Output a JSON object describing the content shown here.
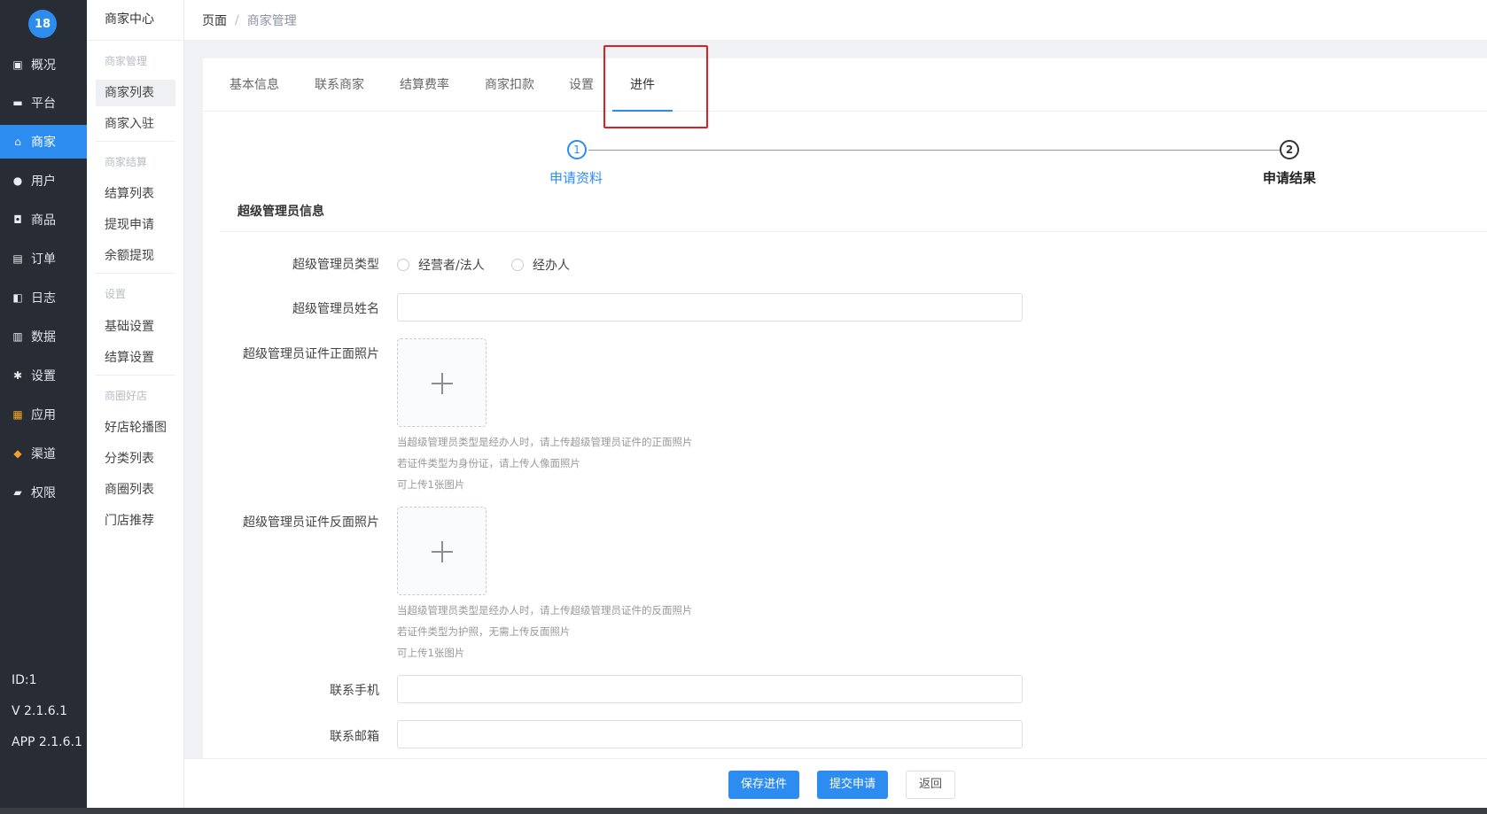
{
  "nav": {
    "logo": "18",
    "items": [
      {
        "label": "概况",
        "icon": "dashboard-icon"
      },
      {
        "label": "平台",
        "icon": "monitor-icon"
      },
      {
        "label": "商家",
        "icon": "shop-icon"
      },
      {
        "label": "用户",
        "icon": "user-icon"
      },
      {
        "label": "商品",
        "icon": "goods-icon"
      },
      {
        "label": "订单",
        "icon": "order-icon"
      },
      {
        "label": "日志",
        "icon": "log-icon"
      },
      {
        "label": "数据",
        "icon": "chart-icon"
      },
      {
        "label": "设置",
        "icon": "gear-icon"
      },
      {
        "label": "应用",
        "icon": "apps-icon"
      },
      {
        "label": "渠道",
        "icon": "cube-icon"
      },
      {
        "label": "权限",
        "icon": "lock-icon"
      }
    ],
    "id": "ID:1",
    "version": "V 2.1.6.1",
    "app_version": "APP 2.1.6.1"
  },
  "submenu": {
    "title": "商家中心",
    "groups": [
      {
        "title": "商家管理",
        "links": [
          "商家列表",
          "商家入驻"
        ]
      },
      {
        "title": "商家结算",
        "links": [
          "结算列表",
          "提现申请",
          "余额提现"
        ]
      },
      {
        "title": "设置",
        "links": [
          "基础设置",
          "结算设置"
        ]
      },
      {
        "title": "商圈好店",
        "links": [
          "好店轮播图",
          "分类列表",
          "商圈列表",
          "门店推荐"
        ]
      }
    ]
  },
  "breadcrumb": {
    "root": "页面",
    "separator": "/",
    "current": "商家管理"
  },
  "tabs": [
    "基本信息",
    "联系商家",
    "结算费率",
    "商家扣款",
    "设置",
    "进件"
  ],
  "steps": [
    {
      "num": "1",
      "label": "申请资料"
    },
    {
      "num": "2",
      "label": "申请结果"
    }
  ],
  "form": {
    "section_title": "超级管理员信息",
    "admin_type_label": "超级管理员类型",
    "admin_type_options": [
      "经营者/法人",
      "经办人"
    ],
    "admin_name_label": "超级管理员姓名",
    "id_front_label": "超级管理员证件正面照片",
    "id_front_hints": [
      "当超级管理员类型是经办人时，请上传超级管理员证件的正面照片",
      "若证件类型为身份证，请上传人像面照片",
      "可上传1张图片"
    ],
    "id_back_label": "超级管理员证件反面照片",
    "id_back_hints": [
      "当超级管理员类型是经办人时，请上传超级管理员证件的反面照片",
      "若证件类型为护照，无需上传反面照片",
      "可上传1张图片"
    ],
    "phone_label": "联系手机",
    "email_label": "联系邮箱"
  },
  "actions": {
    "save": "保存进件",
    "submit": "提交申请",
    "back": "返回"
  },
  "colors": {
    "primary": "#2d8cf0",
    "nav_bg": "#282c34",
    "highlight": "#e02020"
  }
}
